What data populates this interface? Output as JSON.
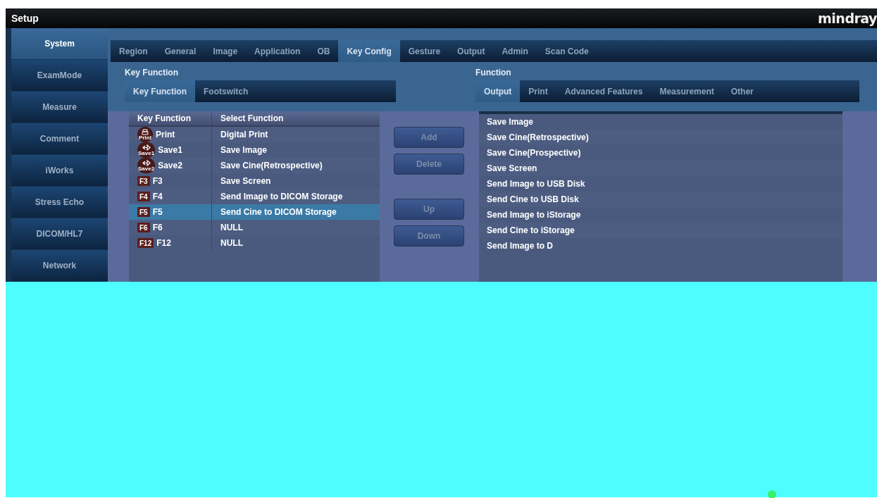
{
  "window": {
    "title": "Setup",
    "logo": "mindray"
  },
  "sidebar": {
    "items": [
      {
        "label": "System",
        "selected": true
      },
      {
        "label": "ExamMode",
        "selected": false
      },
      {
        "label": "Measure",
        "selected": false
      },
      {
        "label": "Comment",
        "selected": false
      },
      {
        "label": "iWorks",
        "selected": false
      },
      {
        "label": "Stress Echo",
        "selected": false
      },
      {
        "label": "DICOM/HL7",
        "selected": false
      },
      {
        "label": "Network",
        "selected": false
      }
    ]
  },
  "tabs": [
    {
      "label": "Region",
      "selected": false
    },
    {
      "label": "General",
      "selected": false
    },
    {
      "label": "Image",
      "selected": false
    },
    {
      "label": "Application",
      "selected": false
    },
    {
      "label": "OB",
      "selected": false
    },
    {
      "label": "Key Config",
      "selected": true
    },
    {
      "label": "Gesture",
      "selected": false
    },
    {
      "label": "Output",
      "selected": false
    },
    {
      "label": "Admin",
      "selected": false
    },
    {
      "label": "Scan Code",
      "selected": false
    }
  ],
  "key_function": {
    "title": "Key Function",
    "tabs": [
      {
        "label": "Key Function",
        "selected": true
      },
      {
        "label": "Footswitch",
        "selected": false
      }
    ],
    "table": {
      "columns": [
        "Key Function",
        "Select Function"
      ],
      "rows": [
        {
          "key": {
            "kind": "print",
            "icon_label": "Print",
            "label": "Print"
          },
          "function": "Digital Print",
          "selected": false
        },
        {
          "key": {
            "kind": "save",
            "icon_label": "Save1",
            "label": "Save1"
          },
          "function": "Save Image",
          "selected": false
        },
        {
          "key": {
            "kind": "save",
            "icon_label": "Save2",
            "label": "Save2"
          },
          "function": "Save Cine(Retrospective)",
          "selected": false
        },
        {
          "key": {
            "kind": "fkey",
            "icon_label": "F3",
            "label": "F3"
          },
          "function": "Save Screen",
          "selected": false
        },
        {
          "key": {
            "kind": "fkey",
            "icon_label": "F4",
            "label": "F4"
          },
          "function": "Send Image to DICOM Storage",
          "selected": false
        },
        {
          "key": {
            "kind": "fkey",
            "icon_label": "F5",
            "label": "F5"
          },
          "function": "Send Cine to DICOM Storage",
          "selected": true
        },
        {
          "key": {
            "kind": "fkey",
            "icon_label": "F6",
            "label": "F6"
          },
          "function": "NULL",
          "selected": false
        },
        {
          "key": {
            "kind": "fkey",
            "icon_label": "F12",
            "label": "F12"
          },
          "function": "NULL",
          "selected": false
        }
      ]
    }
  },
  "buttons": [
    {
      "label": "Add",
      "disabled": true
    },
    {
      "label": "Delete",
      "disabled": true
    },
    {
      "label": "Up",
      "disabled": true
    },
    {
      "label": "Down",
      "disabled": true
    }
  ],
  "function": {
    "title": "Function",
    "tabs": [
      {
        "label": "Output",
        "selected": true
      },
      {
        "label": "Print",
        "selected": false
      },
      {
        "label": "Advanced Features",
        "selected": false
      },
      {
        "label": "Measurement",
        "selected": false
      },
      {
        "label": "Other",
        "selected": false
      }
    ],
    "items": [
      {
        "label": "Save Image",
        "selected": false
      },
      {
        "label": "Save Cine(Retrospective)",
        "selected": false
      },
      {
        "label": "Save Cine(Prospective)",
        "selected": false
      },
      {
        "label": "Save Screen",
        "selected": false
      },
      {
        "label": "Send Image to USB Disk",
        "selected": false
      },
      {
        "label": "Send Cine to USB Disk",
        "selected": false
      },
      {
        "label": "Send Image to iStorage",
        "selected": false
      },
      {
        "label": "Send Cine to iStorage",
        "selected": false
      },
      {
        "label": "Send Image to D",
        "selected": false
      }
    ]
  }
}
